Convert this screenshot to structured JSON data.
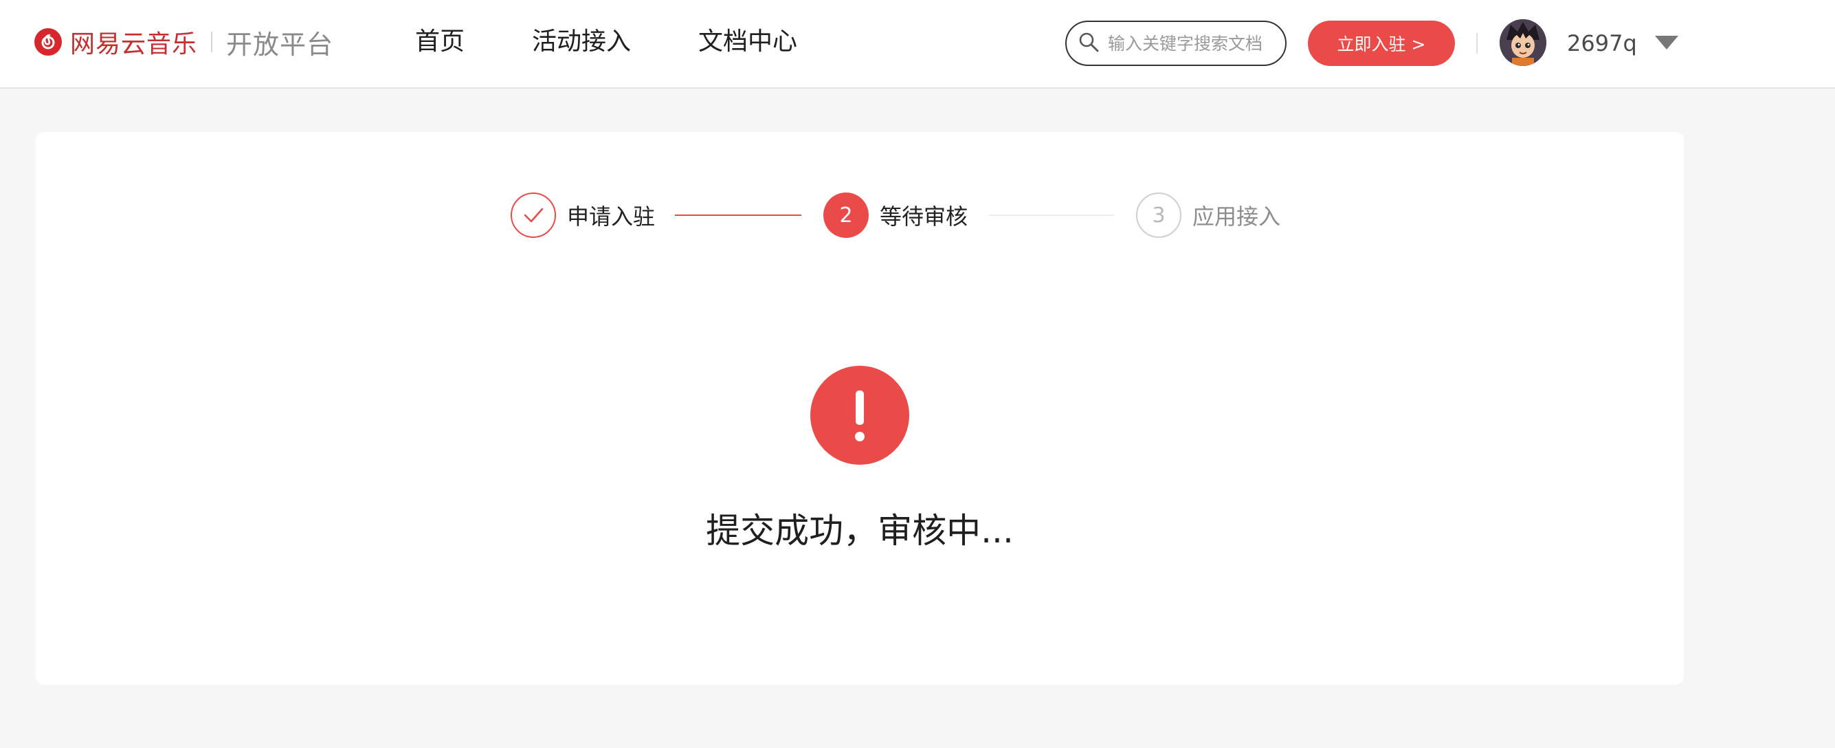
{
  "header": {
    "logo_text": "网易云音乐",
    "platform_text": "开放平台",
    "nav": [
      "首页",
      "活动接入",
      "文档中心"
    ],
    "search_placeholder": "输入关键字搜索文档",
    "join_button": "立即入驻 >",
    "username": "2697q"
  },
  "steps": [
    {
      "label": "申请入驻",
      "state": "done",
      "number": ""
    },
    {
      "label": "等待审核",
      "state": "active",
      "number": "2"
    },
    {
      "label": "应用接入",
      "state": "todo",
      "number": "3"
    }
  ],
  "status": {
    "icon": "exclamation-icon",
    "message": "提交成功，审核中..."
  },
  "colors": {
    "accent": "#ea4b48",
    "brand": "#c62f2f",
    "inactive": "#cfcfcf",
    "background": "#f6f6f6"
  }
}
